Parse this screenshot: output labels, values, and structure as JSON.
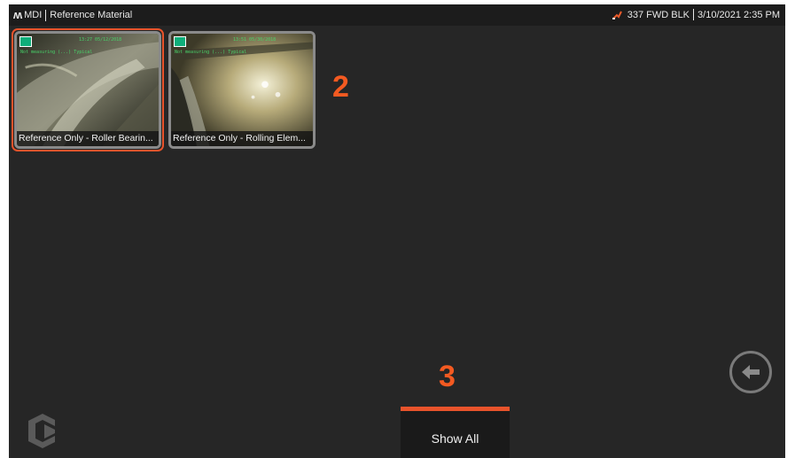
{
  "topbar": {
    "logo": "ʍ",
    "app": "MDI",
    "title": "Reference Material",
    "probe_icon": "probe-icon",
    "location": "337 FWD BLK",
    "datetime": "3/10/2021 2:35 PM"
  },
  "thumbnails": [
    {
      "caption": "Reference Only - Roller Bearin...",
      "selected": true,
      "overlay_time": "13:27 05/12/2018",
      "overlay_label": "Not measuring (...) Typical"
    },
    {
      "caption": "Reference Only - Rolling Elem...",
      "selected": false,
      "overlay_time": "13:51 05/30/2018",
      "overlay_label": "Not measuring (...) Typical"
    }
  ],
  "callouts": {
    "thumbnails": "2",
    "show_all": "3"
  },
  "buttons": {
    "show_all": "Show All",
    "back_icon": "arrow-left-icon"
  },
  "colors": {
    "accent": "#e8532b",
    "callout": "#f45a21",
    "background": "#262626"
  }
}
